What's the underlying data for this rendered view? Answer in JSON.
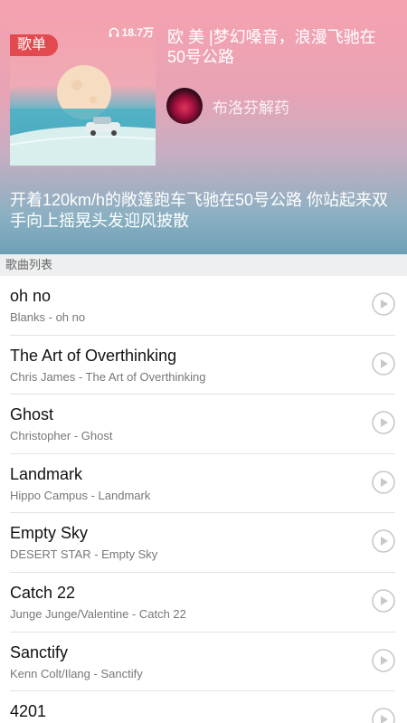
{
  "playlist": {
    "badge": "歌单",
    "play_count": "18.7万",
    "title": "欧 美 |梦幻嗓音，浪漫飞驰在50号公路",
    "creator_name": "布洛芬解药",
    "description": "开着120km/h的敞篷跑车飞驰在50号公路 你站起来双手向上摇晃头发迎风披散"
  },
  "section": {
    "label": "歌曲列表"
  },
  "songs": [
    {
      "title": "oh no",
      "subtitle": "Blanks - oh no"
    },
    {
      "title": "The Art of Overthinking",
      "subtitle": "Chris James - The Art of Overthinking"
    },
    {
      "title": "Ghost",
      "subtitle": "Christopher - Ghost"
    },
    {
      "title": "Landmark",
      "subtitle": "Hippo Campus - Landmark"
    },
    {
      "title": "Empty Sky",
      "subtitle": "DESERT STAR - Empty Sky"
    },
    {
      "title": "Catch 22",
      "subtitle": "Junge Junge/Valentine - Catch 22"
    },
    {
      "title": "Sanctify",
      "subtitle": "Kenn Colt/Ilang - Sanctify"
    },
    {
      "title": "4201",
      "subtitle": ""
    }
  ],
  "icons": {
    "headphone": "headphone-icon",
    "play": "play-circle-icon"
  },
  "colors": {
    "badge": "#e24a50",
    "header_top": "#f5a2b0",
    "header_bottom": "#6f9fb6",
    "section_bg": "#eeeff0",
    "play_icon": "#c8c8c8"
  }
}
